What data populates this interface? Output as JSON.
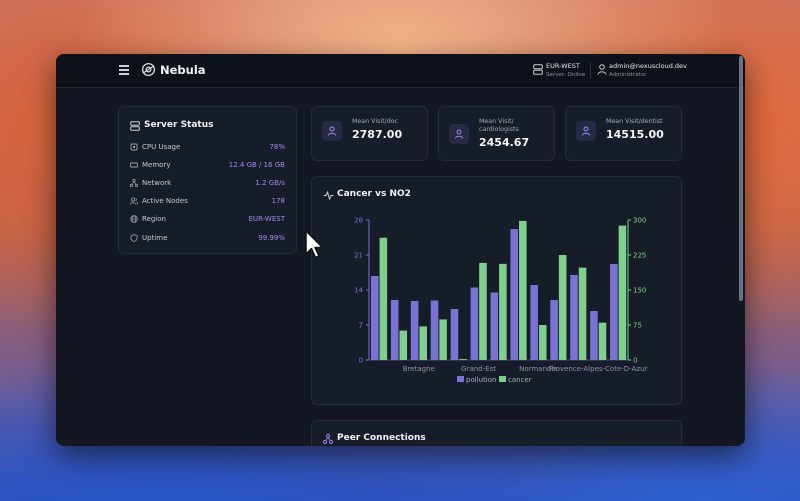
{
  "app": {
    "brand": "Nebula"
  },
  "header": {
    "region": "EUR-WEST",
    "server_status": "Server: Online",
    "user_email": "admin@nexuscloud.dev",
    "user_role": "Administrator"
  },
  "server_status": {
    "title": "Server Status",
    "rows": [
      {
        "label": "CPU Usage",
        "value": "78%",
        "icon": "cpu-icon"
      },
      {
        "label": "Memory",
        "value": "12.4 GB / 16 GB",
        "icon": "memory-icon"
      },
      {
        "label": "Network",
        "value": "1.2 GB/s",
        "icon": "network-icon"
      },
      {
        "label": "Active Nodes",
        "value": "178",
        "icon": "nodes-icon"
      },
      {
        "label": "Region",
        "value": "EUR-WEST",
        "icon": "globe-icon"
      },
      {
        "label": "Uptime",
        "value": "99.99%",
        "icon": "shield-icon"
      }
    ]
  },
  "stats": [
    {
      "label_lines": [
        "Mean Visit/doc"
      ],
      "value": "2787.00",
      "icon": "user-icon"
    },
    {
      "label_lines": [
        "Mean Visit/",
        "cardiologists"
      ],
      "value": "2454.67",
      "icon": "user-icon"
    },
    {
      "label_lines": [
        "Mean Visit/dentist"
      ],
      "value": "14515.00",
      "icon": "user-icon"
    }
  ],
  "chart_title": "Cancer vs NO2",
  "peer_title": "Peer Connections",
  "colors": {
    "accent": "#a08cf0",
    "pollution": "#7b72d6",
    "cancer": "#7fd08d"
  },
  "chart_data": {
    "type": "bar",
    "title": "Cancer vs NO2",
    "categories": [
      "",
      "",
      "Bretagne",
      "",
      "",
      "Grand-Est",
      "",
      "",
      "Normandie",
      "",
      "",
      "Provence-Alpes-Cote-D-Azur",
      ""
    ],
    "y_left": {
      "min": 0,
      "max": 28,
      "ticks": [
        0,
        7,
        14,
        21,
        28
      ]
    },
    "y_right": {
      "min": 0,
      "max": 300,
      "ticks": [
        0,
        75,
        150,
        225,
        300
      ]
    },
    "series": [
      {
        "name": "pollution",
        "axis": "left",
        "values": [
          16.8,
          12.0,
          11.8,
          11.9,
          10.2,
          14.5,
          13.5,
          26.2,
          15.0,
          12.0,
          17.0,
          9.8,
          19.2
        ]
      },
      {
        "name": "cancer",
        "axis": "right",
        "values": [
          262,
          63,
          72,
          87,
          2,
          208,
          206,
          298,
          75,
          225,
          198,
          80,
          288
        ]
      }
    ],
    "legend": "bottom",
    "grid": false
  }
}
